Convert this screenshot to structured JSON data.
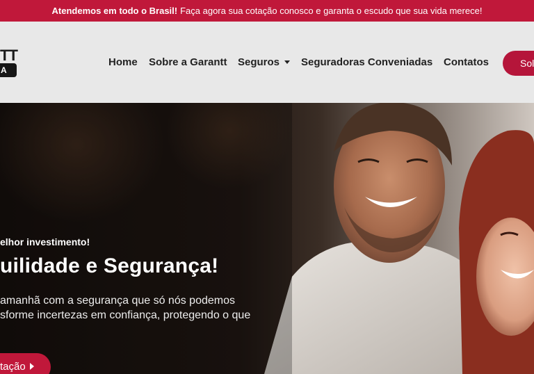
{
  "topbar": {
    "bold": "Atendemos em todo o Brasil!",
    "text": "Faça agora sua cotação conosco e garanta o escudo que sua vida merece!"
  },
  "logo": {
    "text": "TT",
    "badge": "A"
  },
  "nav": {
    "home": "Home",
    "about": "Sobre a Garantt",
    "insurance": "Seguros",
    "insurers": "Seguradoras Conveniadas",
    "contacts": "Contatos",
    "cta": "Soli"
  },
  "hero": {
    "kicker": "elhor investimento!",
    "headline": "uilidade e Segurança!",
    "desc_line1": "amanhã com a segurança que só nós podemos",
    "desc_line2": "sforme incertezas em confiança, protegendo o que",
    "cta": "tação"
  },
  "colors": {
    "brand": "#c0183a",
    "header_bg": "#e8e8e8",
    "nav_text": "#222222"
  },
  "icons": {
    "dropdown": "chevron-down-icon",
    "cta_arrow": "play-icon"
  }
}
